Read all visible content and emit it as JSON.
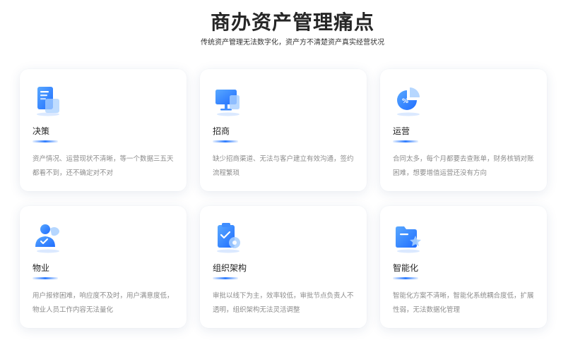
{
  "header": {
    "title": "商办资产管理痛点",
    "subtitle": "传统资产管理无法数字化，资产方不清楚资产真实经营状况"
  },
  "cards": [
    {
      "icon": "document-icon",
      "title": "决策",
      "desc": "资产情况、运营现状不清晰，等一个数据三五天都看不到，还不确定对不对"
    },
    {
      "icon": "monitor-icon",
      "title": "招商",
      "desc": "缺少招商渠道、无法与客户建立有效沟通，签约流程繁琐"
    },
    {
      "icon": "pie-chart-icon",
      "title": "运营",
      "desc": "合同太多，每个月都要去查账单，财务核销对账困难，想要增值运营还没有方向"
    },
    {
      "icon": "user-icon",
      "title": "物业",
      "desc": "用户报修困难，响应度不及时，用户满意度低，物业人员工作内容无法量化"
    },
    {
      "icon": "clipboard-icon",
      "title": "组织架构",
      "desc": "审批以线下为主，效率较低，审批节点负责人不透明，组织架构无法灵活调整"
    },
    {
      "icon": "folder-icon",
      "title": "智能化",
      "desc": "智能化方案不清晰，智能化系统耦合度低，扩展性弱，无法数据化管理"
    }
  ],
  "colors": {
    "accent": "#2f7dff",
    "accent_light": "#8fc3ff",
    "title": "#262626",
    "desc": "#8c8c8c"
  }
}
